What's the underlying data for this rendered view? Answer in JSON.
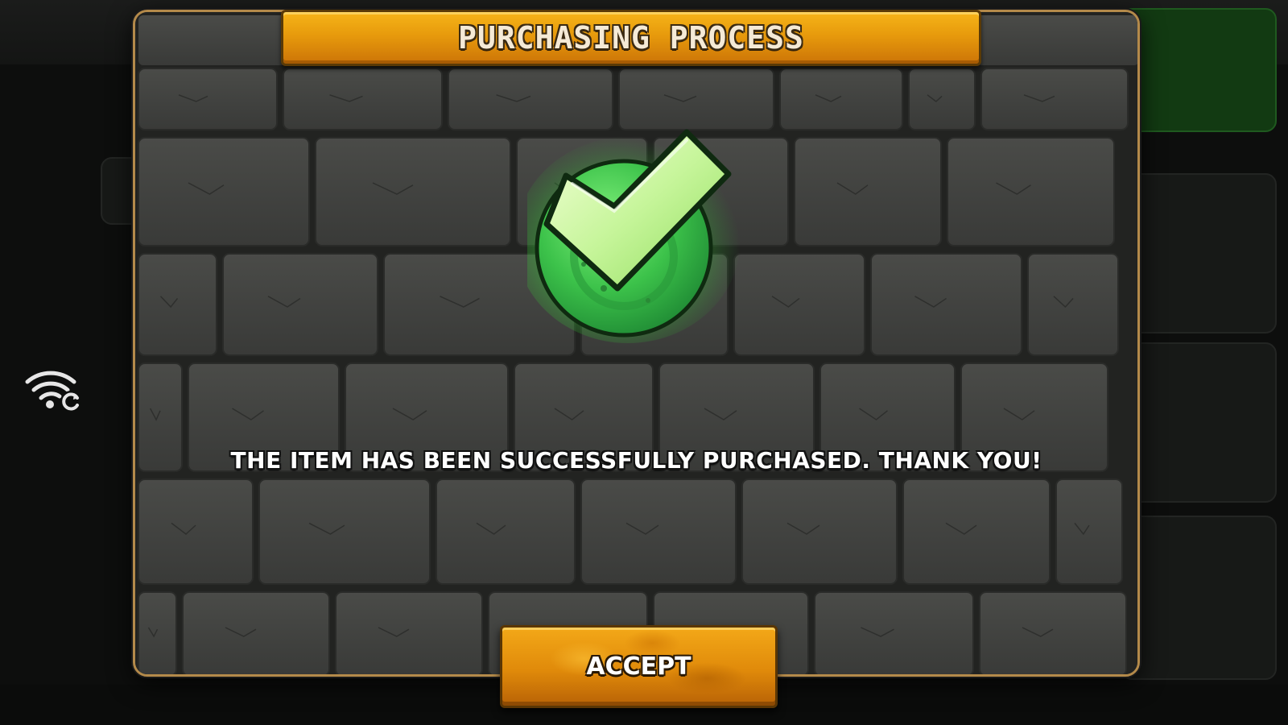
{
  "dialog": {
    "title": "PURCHASING PROCESS",
    "message": "THE ITEM HAS BEEN SUCCESSFULLY PURCHASED. THANK YOU!",
    "accept_label": "ACCEPT",
    "icon": "success-check-icon"
  },
  "background": {
    "network_icon": "wifi-refresh-icon"
  },
  "colors": {
    "title_bar": "#e79a0c",
    "accept_button": "#e08a0a",
    "check_green": "#3fd94a",
    "frame_border": "#b48a4a",
    "wall": "#3d3e3c"
  }
}
